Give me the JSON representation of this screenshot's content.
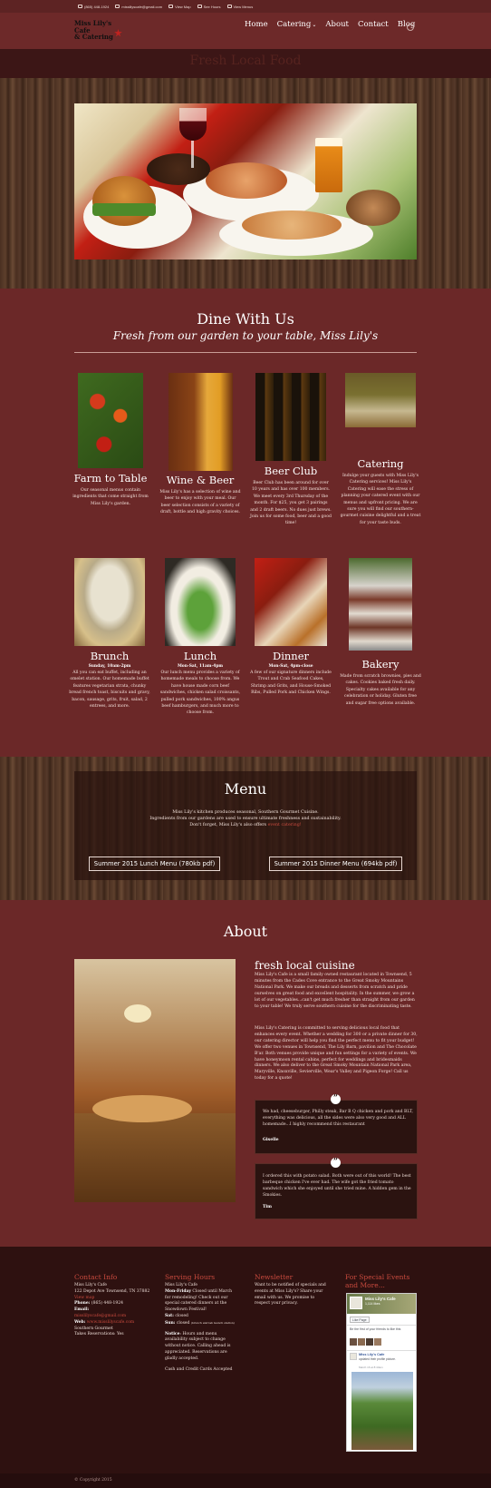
{
  "topbar": {
    "phone": "(865) 448-1924",
    "email": "misslilyscafe@gmail.com",
    "view_map": "View Map",
    "see_hours": "See Hours",
    "view_menus": "View Menus"
  },
  "logo": {
    "line1": "Miss Lily's Cafe",
    "line2": "& Catering"
  },
  "nav": {
    "home": "Home",
    "catering": "Catering",
    "about": "About",
    "contact": "Contact",
    "blog": "Blog"
  },
  "band_title": "Fresh Local Food",
  "dine": {
    "title": "Dine With Us",
    "subtitle": "Fresh from our garden to your table, Miss Lily's",
    "row1": [
      {
        "name": "Farm to Table",
        "desc": "Our seasonal menus contain ingredients that come straight from Miss Lily's garden."
      },
      {
        "name": "Wine & Beer",
        "desc": "Miss Lily's has a selection of wine and beer to enjoy with your meal. Our beer selection consists of a variety of draft, bottle and high gravity choices."
      },
      {
        "name": "Beer Club",
        "desc": "Beer Club has been around for over 10 years and has over 100 members. We meet every 3rd Thursday of the month. For $25, you get 3 pairings and 2 draft beers. No dues just brews. Join us for some food, beer and a good time!"
      },
      {
        "name": "Catering",
        "desc": "Indulge your guests with Miss Lily's Catering services! Miss Lily's Catering will ease the stress of planning your catered event with our menus and upfront pricing. We are sure you will find our southern-gourmet cuisine delightful and a treat for your taste buds."
      }
    ],
    "row2": [
      {
        "name": "Brunch",
        "time": "Sunday, 10am-2pm",
        "desc": "All you can eat buffet, including an omelet station. Our homemade buffet features vegetarian strata, chunky bread french toast, biscuits and gravy, bacon, sausage, grits, fruit, salad, 2 entrees, and more."
      },
      {
        "name": "Lunch",
        "time": "Mon-Sat, 11am-4pm",
        "desc": "Our lunch menu provides a variety of homemade meals to choose from. We have house made corn beef sandwiches, chicken salad croissants, pulled pork sandwiches, 100% angus beef hamburgers, and much more to choose from."
      },
      {
        "name": "Dinner",
        "time": "Mon-Sat, 4pm-close",
        "desc": "A few of our signature dinners include Trout and Crab Seafood Cakes, Shrimp and Grits, and House-Smoked Ribs, Pulled Pork and Chicken Wings."
      },
      {
        "name": "Bakery",
        "time": "",
        "desc": "Made from scratch brownies, pies and cakes. Cookies baked fresh daily. Specialty cakes available for any celebration or holiday. Gluten free and sugar free options available."
      }
    ]
  },
  "menu": {
    "title": "Menu",
    "line1": "Miss Lily's kitchen produces seasonal, Southern Gourmet Cuisine.",
    "line2": "Ingredients from our gardens are used to ensure ultimate freshness and sustainability.",
    "line3a": "Don't forget, Miss Lily's also offers ",
    "line3b": "event catering!",
    "btn_lunch": "Summer 2015 Lunch Menu (780kb pdf)",
    "btn_dinner": "Summer 2015 Dinner Menu (694kb pdf)"
  },
  "about": {
    "title": "About",
    "heading": "fresh local cuisine",
    "p1": "Miss Lily's Cafe is a small family owned restaurant located in Townsend, 5 minutes from the Cades Cove entrance to the Great Smoky Mountains National Park. We make our breads and desserts from scratch and pride ourselves on great food and excellent hospitality. In the summer, we grow a lot of our vegetables...can't get much fresher than straight from our garden to your table! We truly serve southern cuisine for the discriminating taste.",
    "p2": "Miss Lily's Catering is committed to serving delicious local food that enhances every event. Whether a wedding for 300 or a private dinner for 30, our catering director will help you find the perfect menu to fit your budget! We offer two venues in Townsend, The Lily Barn, pavilion and The Chocolate B'ar. Both venues provide unique and fun settings for a variety of events. We have honeymoon rental cabins, perfect for weddings and bridesmaids dinners. We also deliver to the Great Smoky Mountain National Park area, Maryville, Knoxville, Sevierville, Wear's Valley and Pigeon Forge! Call us today for a quote!",
    "t1_text": "We had, cheeseburger, Philly steak, Bar B Q chicken and pork and BLT, everything was delicious, all the sides were also very good and ALL homemade...I highly recommend this restaurant",
    "t1_author": "Giselle",
    "t2_text": "I ordered this with potato salad. Both were out of this world! The best barbeque chicken I've ever had. The wife got the fried tomato sandwich which she enjoyed until she tried mine. A hidden gem in the Smokies.",
    "t2_author": "Tim"
  },
  "footer": {
    "contact": {
      "heading": "Contact Info",
      "name": "Miss Lily's Cafe",
      "address": "122 Depot Ave Townsend, TN 37882",
      "map": "View map",
      "phone_label": "Phone:",
      "phone": "(865) 448-1924",
      "email_label": "Email:",
      "email": "misslilyscafe@gmail.com",
      "web_label": "Web:",
      "web": "www.misslilyscafe.com",
      "l1": "Southern Gourmet",
      "l2": "Takes Reservations: Yes"
    },
    "hours": {
      "heading": "Serving Hours",
      "name": "Miss Lily's Cafe",
      "mf_label": "Mon-Friday",
      "mf": " Closed until March for remodeling! Check out our special catered dinners at the Snowdown Festival!",
      "sat_label": "Sat:",
      "sat": " closed",
      "sun_label": "Sun:",
      "sun": " closed",
      "sun_small": "(brunch and lab launch station)",
      "notice_label": "Notice",
      "notice": ": Hours and menu availability subject to change without notice. Calling ahead is appreciated. Reservations are gladly accepted.",
      "cards": "Cash and Credit Cards Accepted"
    },
    "newsletter": {
      "heading": "Newsletter",
      "text": "Want to be notified of specials and events at Miss Lily's? Share your email with us. We promise to respect your privacy."
    },
    "events": {
      "heading": "For Special Events and More...",
      "fb_page": "Miss Lily's Cafe",
      "fb_likes": "1,114 likes",
      "fb_like_btn": "Like Page",
      "fb_friends": "Be the first of your friends to like this",
      "fb_post_name": "Miss Lily's Cafe",
      "fb_post_text": "updated their profile picture.",
      "fb_post_time": "March 16 at 8:43am"
    },
    "copyright": "© Copyright 2015"
  },
  "colors": {
    "background": "#6b2828",
    "accent": "#c84a3e",
    "footer": "#2e1110"
  }
}
